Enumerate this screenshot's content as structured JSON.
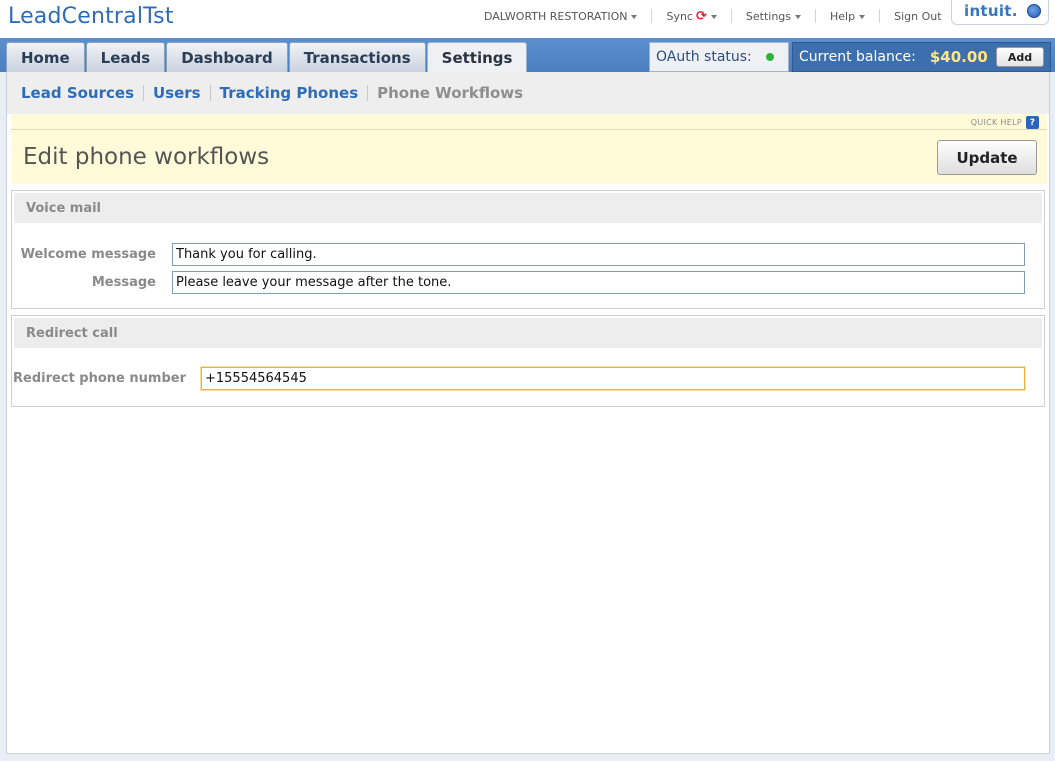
{
  "app": {
    "title": "LeadCentralTst"
  },
  "topnav": {
    "company": "DALWORTH RESTORATION",
    "sync": "Sync",
    "settings": "Settings",
    "help": "Help",
    "signout": "Sign Out"
  },
  "brand": {
    "logo": "intuit."
  },
  "tabs": [
    {
      "label": "Home"
    },
    {
      "label": "Leads"
    },
    {
      "label": "Dashboard"
    },
    {
      "label": "Transactions"
    },
    {
      "label": "Settings",
      "active": true
    }
  ],
  "status": {
    "oauth_label": "OAuth status:",
    "oauth_color": "#2db33a",
    "balance_label": "Current balance:",
    "balance_amount": "$40.00",
    "add_label": "Add"
  },
  "subnav": {
    "items": [
      {
        "label": "Lead Sources"
      },
      {
        "label": "Users"
      },
      {
        "label": "Tracking Phones"
      },
      {
        "label": "Phone Workflows",
        "current": true
      }
    ]
  },
  "page": {
    "quick_help": "QUICK HELP",
    "quick_help_icon": "?",
    "title": "Edit phone workflows",
    "update_label": "Update"
  },
  "voicemail": {
    "heading": "Voice mail",
    "welcome_label": "Welcome message",
    "welcome_value": "Thank you for calling.",
    "message_label": "Message",
    "message_value": "Please leave your message after the tone."
  },
  "redirect": {
    "heading": "Redirect call",
    "phone_label": "Redirect phone number",
    "phone_value": "+15554564545"
  }
}
